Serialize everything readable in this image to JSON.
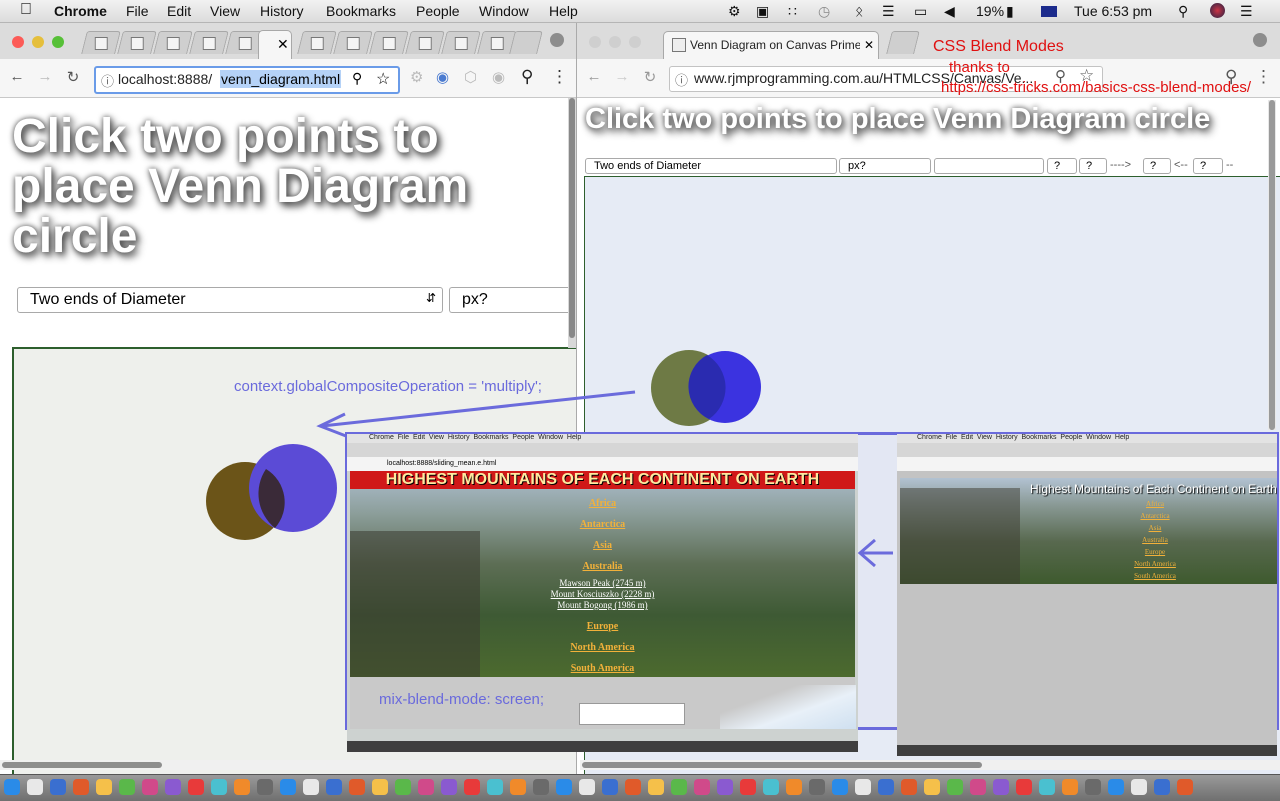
{
  "menubar": {
    "apple": "",
    "app": "Chrome",
    "items": [
      "File",
      "Edit",
      "View",
      "History",
      "Bookmarks",
      "People",
      "Window",
      "Help"
    ],
    "battery": "19%",
    "clock": "Tue 6:53 pm"
  },
  "left_window": {
    "url_host": "localhost:8888/",
    "url_path": "venn_diagram.html",
    "heading": "Click two points to place Venn Diagram circle",
    "select_mode": "Two ends of Diameter",
    "select_unit": "px?",
    "annotation_js": "context.globalCompositeOperation = 'multiply';",
    "circle_colors": {
      "left": "#6b5418",
      "right": "#5b4bd6",
      "overlap": "#3a2a38"
    }
  },
  "right_window": {
    "tab_title": "Venn Diagram on Canvas Prime",
    "url": "www.rjmprogramming.com.au/HTMLCSS/Canvas/Ve...",
    "heading": "Click two points to place Venn Diagram circle",
    "select_mode": "Two ends of Diameter",
    "select_unit": "px?",
    "q1": "?",
    "q2": "?",
    "arrow_right": "---->",
    "q3": "?",
    "arrow_left": "<--",
    "q4": "?",
    "dashes": "--"
  },
  "callout": {
    "title": "CSS Blend Modes",
    "thanks": "thanks to",
    "link": "https://css-tricks.com/basics-css-blend-modes/"
  },
  "screenshot_left": {
    "title": "Highest Mountains of Each Continent on Earth",
    "links": [
      "Africa",
      "Antarctica",
      "Asia",
      "Australia"
    ],
    "peaks": [
      "Mawson Peak (2745 m)",
      "Mount Kosciuszko (2228 m)",
      "Mount Bogong (1986 m)"
    ],
    "links2": [
      "Europe",
      "North America",
      "South America"
    ],
    "url": "localhost:8888/sliding_mean.e.html",
    "annotation_css": "mix-blend-mode: screen;"
  },
  "screenshot_right": {
    "title": "Highest Mountains of Each Continent on Earth",
    "links": [
      "Africa",
      "Antarctica",
      "Asia",
      "Australia",
      "Europe",
      "North America",
      "South America"
    ]
  }
}
